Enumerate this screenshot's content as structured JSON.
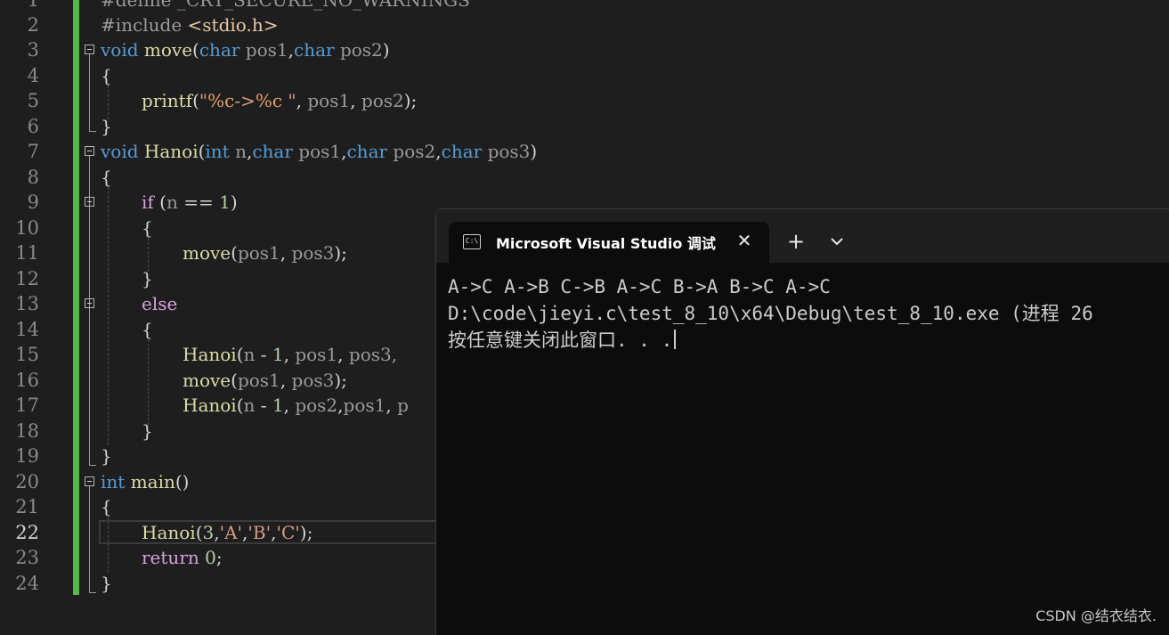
{
  "editor": {
    "line_numbers": [
      "1",
      "2",
      "3",
      "4",
      "5",
      "6",
      "7",
      "8",
      "9",
      "10",
      "11",
      "12",
      "13",
      "14",
      "15",
      "16",
      "17",
      "18",
      "19",
      "20",
      "21",
      "22",
      "23",
      "24"
    ],
    "active_line": "22",
    "lines": {
      "l1": {
        "a": "#define ",
        "b": "_CRT_SECURE_NO_WARNINGS"
      },
      "l2": {
        "a": "#include ",
        "b": "<stdio.h>"
      },
      "l3": {
        "t1": "void",
        "t2": " ",
        "t3": "move",
        "t4": "(",
        "t5": "char",
        "t6": " ",
        "t7": "pos1",
        "t8": ",",
        "t9": "char",
        "t10": " ",
        "t11": "pos2",
        "t12": ")"
      },
      "l4": "{",
      "l5": {
        "t1": "printf",
        "t2": "(",
        "t3": "\"",
        "t4": "%c",
        "t5": "->",
        "t6": "%c",
        "t7": " \"",
        "t8": ", ",
        "t9": "pos1",
        "t10": ", ",
        "t11": "pos2",
        "t12": ");"
      },
      "l6": "}",
      "l7": {
        "t1": "void",
        "t2": " ",
        "t3": "Hanoi",
        "t4": "(",
        "t5": "int",
        "t6": " ",
        "t7": "n",
        "t8": ",",
        "t9": "char",
        "t10": " ",
        "t11": "pos1",
        "t12": ",",
        "t13": "char",
        "t14": " ",
        "t15": "pos2",
        "t16": ",",
        "t17": "char",
        "t18": " ",
        "t19": "pos3",
        "t20": ")"
      },
      "l8": "{",
      "l9": {
        "t1": "if",
        "t2": " (",
        "t3": "n",
        "t4": " == ",
        "t5": "1",
        "t6": ")"
      },
      "l10": "{",
      "l11": {
        "t1": "move",
        "t2": "(",
        "t3": "pos1",
        "t4": ", ",
        "t5": "pos3",
        "t6": ");"
      },
      "l12": "}",
      "l13": "else",
      "l14": "{",
      "l15": {
        "t1": "Hanoi",
        "t2": "(",
        "t3": "n",
        "t4": " - ",
        "t5": "1",
        "t6": ", ",
        "t7": "pos1",
        "t8": ", ",
        "t9": "pos3,"
      },
      "l16": {
        "t1": "move",
        "t2": "(",
        "t3": "pos1",
        "t4": ", ",
        "t5": "pos3",
        "t6": ");"
      },
      "l17": {
        "t1": "Hanoi",
        "t2": "(",
        "t3": "n",
        "t4": " - ",
        "t5": "1",
        "t6": ", ",
        "t7": "pos2",
        "t8": ",",
        "t9": "pos1",
        "t10": ", ",
        "t11": "p"
      },
      "l18": "}",
      "l19": "}",
      "l20": {
        "t1": "int",
        "t2": " ",
        "t3": "main",
        "t4": "()"
      },
      "l21": "{",
      "l22": {
        "t1": "Hanoi",
        "t2": "(",
        "t3": "3",
        "t4": ",",
        "t5": "'A'",
        "t6": ",",
        "t7": "'B'",
        "t8": ",",
        "t9": "'C'",
        "t10": ");"
      },
      "l23": {
        "t1": "return",
        "t2": " ",
        "t3": "0",
        "t4": ";"
      },
      "l24": "}"
    }
  },
  "terminal": {
    "tab_title": "Microsoft Visual Studio 调试控制台",
    "tab_icon_text": "C:\\",
    "close_glyph": "✕",
    "add_glyph": "+",
    "output_line1": "A->C A->B C->B A->C B->A B->C A->C",
    "output_line2": "D:\\code\\jieyi.c\\test_8_10\\x64\\Debug\\test_8_10.exe (进程 26",
    "output_line3": "按任意键关闭此窗口. . ."
  },
  "watermark": "CSDN @结衣结衣."
}
